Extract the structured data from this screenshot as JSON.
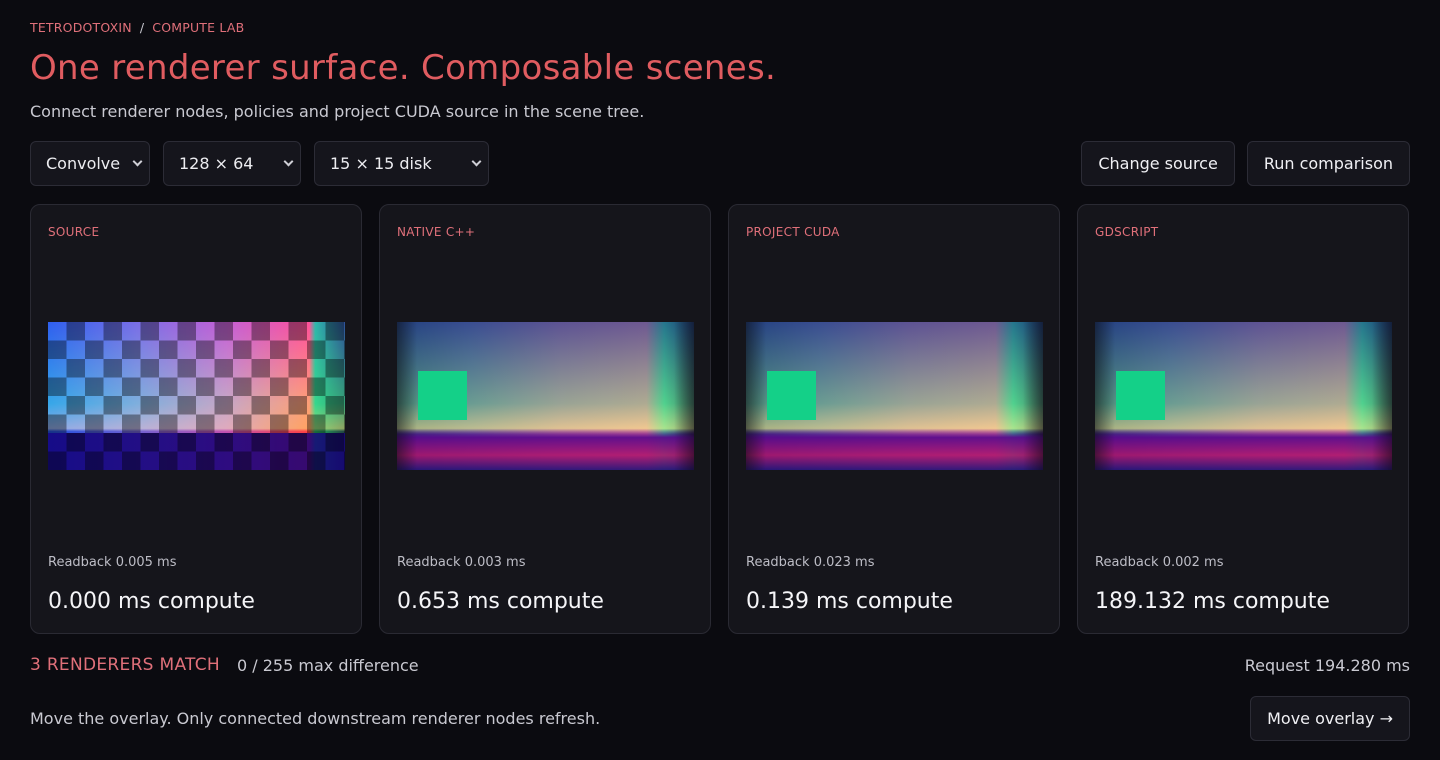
{
  "breadcrumb": {
    "org": "TETRODOTOXIN",
    "separator": "/",
    "section": "COMPUTE LAB"
  },
  "title": "One renderer surface. Composable scenes.",
  "subtitle": "Connect renderer nodes, policies and project CUDA source in the scene tree.",
  "controls": {
    "operation": "Convolve",
    "size": "128 × 64",
    "kernel": "15 × 15 disk"
  },
  "actions": {
    "change_source": "Change source",
    "run_comparison": "Run comparison"
  },
  "cards": [
    {
      "label": "SOURCE",
      "readback": "Readback 0.005 ms",
      "compute": "0.000 ms compute"
    },
    {
      "label": "NATIVE C++",
      "readback": "Readback 0.003 ms",
      "compute": "0.653 ms compute"
    },
    {
      "label": "PROJECT CUDA",
      "readback": "Readback 0.023 ms",
      "compute": "0.139 ms compute"
    },
    {
      "label": "GDSCRIPT",
      "readback": "Readback 0.002 ms",
      "compute": "189.132 ms compute"
    }
  ],
  "summary": {
    "match": "3 RENDERERS MATCH",
    "difference": "0 / 255 max difference",
    "request": "Request 194.280 ms"
  },
  "hint": "Move the overlay. Only connected downstream renderer nodes refresh.",
  "move_overlay": "Move overlay →",
  "colors": {
    "accent": "#e05c60",
    "label": "#e0707a",
    "overlay": "#14d088",
    "background": "#0b0b10"
  }
}
